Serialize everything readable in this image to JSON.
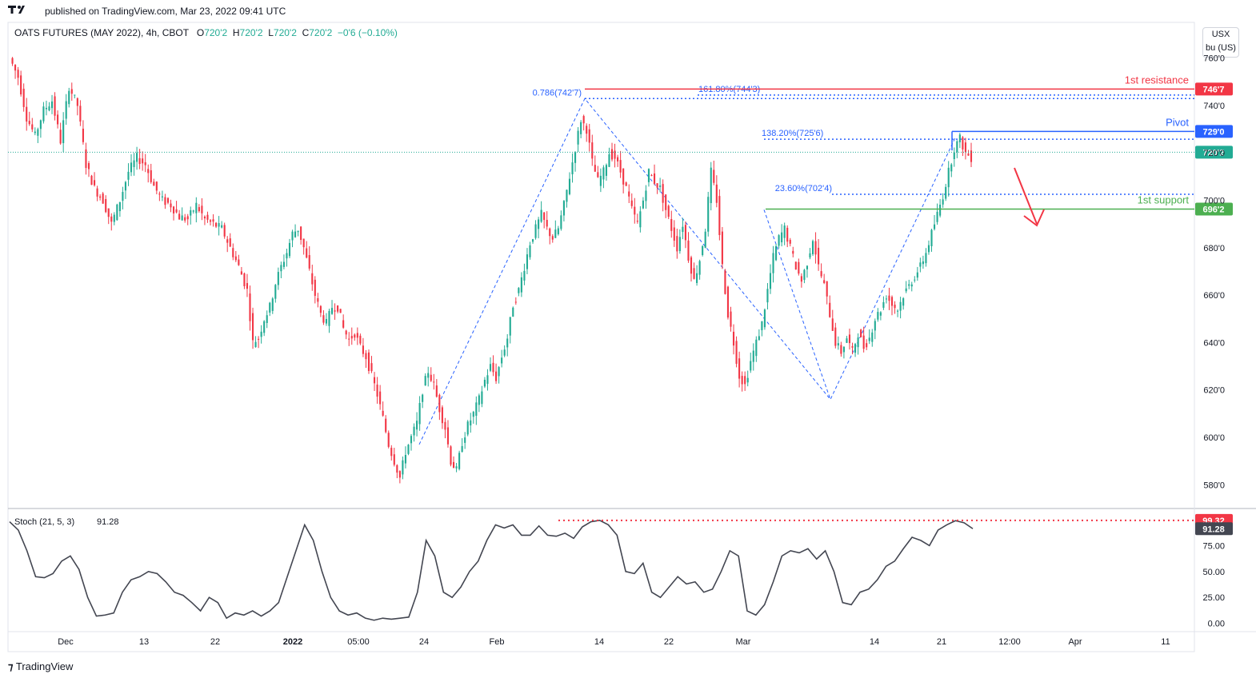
{
  "header": {
    "published_text": "published on TradingView.com, Mar 23, 2022 09:41 UTC",
    "symbol": "OATS FUTURES (MAY 2022), 4h, CBOT",
    "ohlc": {
      "o_label": "O",
      "o": "720'2",
      "h_label": "H",
      "h": "720'2",
      "l_label": "L",
      "l": "720'2",
      "c_label": "C",
      "c": "720'2",
      "change": "−0'6 (−0.10%)"
    }
  },
  "unit_box": {
    "line1": "USX",
    "line2": "bu (US)"
  },
  "footer": {
    "brand": "TradingView"
  },
  "colors": {
    "up": "#22ab94",
    "down": "#f23645",
    "blue": "#2962ff",
    "resist": "#f23645",
    "support": "#4caf50",
    "grid": "#e0e3eb",
    "stoch": "#434651"
  },
  "chart_data": [
    {
      "type": "candlestick",
      "title": "OATS FUTURES (MAY 2022), 4h, CBOT",
      "ylim": [
        570,
        775
      ],
      "y_ticks": [
        {
          "v": 760,
          "label": "760'0"
        },
        {
          "v": 740,
          "label": "740'0"
        },
        {
          "v": 720,
          "label": "720'0"
        },
        {
          "v": 700,
          "label": "700'0"
        },
        {
          "v": 680,
          "label": "680'0"
        },
        {
          "v": 660,
          "label": "660'0"
        },
        {
          "v": 640,
          "label": "640'0"
        },
        {
          "v": 620,
          "label": "620'0"
        },
        {
          "v": 600,
          "label": "600'0"
        },
        {
          "v": 580,
          "label": "580'0"
        }
      ],
      "x_ticks": [
        "Dec",
        "13",
        "22",
        "2022",
        "05:00",
        "24",
        "Feb",
        "14",
        "22",
        "Mar",
        "14",
        "21",
        "12:00",
        "Apr",
        "11"
      ],
      "close_path": [
        [
          0,
          760
        ],
        [
          3,
          752
        ],
        [
          6,
          735
        ],
        [
          9,
          727
        ],
        [
          12,
          738
        ],
        [
          15,
          742
        ],
        [
          18,
          725
        ],
        [
          21,
          748
        ],
        [
          24,
          740
        ],
        [
          27,
          715
        ],
        [
          30,
          705
        ],
        [
          33,
          700
        ],
        [
          36,
          690
        ],
        [
          39,
          700
        ],
        [
          42,
          712
        ],
        [
          45,
          718
        ],
        [
          48,
          715
        ],
        [
          51,
          706
        ],
        [
          54,
          700
        ],
        [
          57,
          698
        ],
        [
          60,
          693
        ],
        [
          63,
          692
        ],
        [
          66,
          698
        ],
        [
          69,
          692
        ],
        [
          72,
          690
        ],
        [
          75,
          688
        ],
        [
          78,
          680
        ],
        [
          81,
          672
        ],
        [
          84,
          662
        ],
        [
          86,
          640
        ],
        [
          88,
          642
        ],
        [
          90,
          650
        ],
        [
          92,
          655
        ],
        [
          94,
          665
        ],
        [
          96,
          672
        ],
        [
          98,
          678
        ],
        [
          100,
          686
        ],
        [
          102,
          688
        ],
        [
          104,
          680
        ],
        [
          106,
          670
        ],
        [
          108,
          660
        ],
        [
          110,
          652
        ],
        [
          112,
          648
        ],
        [
          114,
          655
        ],
        [
          116,
          655
        ],
        [
          118,
          646
        ],
        [
          120,
          641
        ],
        [
          122,
          644
        ],
        [
          124,
          638
        ],
        [
          126,
          634
        ],
        [
          128,
          626
        ],
        [
          130,
          618
        ],
        [
          132,
          608
        ],
        [
          134,
          597
        ],
        [
          136,
          590
        ],
        [
          138,
          583
        ],
        [
          140,
          594
        ],
        [
          142,
          600
        ],
        [
          144,
          606
        ],
        [
          146,
          620
        ],
        [
          148,
          628
        ],
        [
          150,
          622
        ],
        [
          152,
          612
        ],
        [
          154,
          604
        ],
        [
          156,
          590
        ],
        [
          158,
          586
        ],
        [
          160,
          598
        ],
        [
          162,
          605
        ],
        [
          164,
          610
        ],
        [
          166,
          616
        ],
        [
          168,
          624
        ],
        [
          170,
          630
        ],
        [
          172,
          625
        ],
        [
          174,
          634
        ],
        [
          176,
          642
        ],
        [
          178,
          656
        ],
        [
          180,
          662
        ],
        [
          182,
          672
        ],
        [
          184,
          682
        ],
        [
          186,
          688
        ],
        [
          188,
          694
        ],
        [
          190,
          688
        ],
        [
          192,
          684
        ],
        [
          194,
          688
        ],
        [
          196,
          698
        ],
        [
          198,
          710
        ],
        [
          200,
          722
        ],
        [
          202,
          734
        ],
        [
          204,
          730
        ],
        [
          206,
          716
        ],
        [
          208,
          708
        ],
        [
          210,
          712
        ],
        [
          212,
          720
        ],
        [
          214,
          718
        ],
        [
          216,
          712
        ],
        [
          218,
          705
        ],
        [
          220,
          696
        ],
        [
          222,
          690
        ],
        [
          224,
          700
        ],
        [
          226,
          712
        ],
        [
          228,
          708
        ],
        [
          230,
          705
        ],
        [
          232,
          696
        ],
        [
          234,
          688
        ],
        [
          236,
          680
        ],
        [
          238,
          690
        ],
        [
          240,
          676
        ],
        [
          242,
          666
        ],
        [
          244,
          675
        ],
        [
          246,
          688
        ],
        [
          248,
          712
        ],
        [
          250,
          700
        ],
        [
          252,
          672
        ],
        [
          254,
          652
        ],
        [
          256,
          640
        ],
        [
          258,
          626
        ],
        [
          260,
          622
        ],
        [
          262,
          632
        ],
        [
          264,
          640
        ],
        [
          266,
          648
        ],
        [
          268,
          662
        ],
        [
          270,
          676
        ],
        [
          272,
          684
        ],
        [
          274,
          688
        ],
        [
          276,
          680
        ],
        [
          278,
          672
        ],
        [
          280,
          666
        ],
        [
          282,
          674
        ],
        [
          284,
          684
        ],
        [
          286,
          672
        ],
        [
          288,
          664
        ],
        [
          290,
          652
        ],
        [
          292,
          640
        ],
        [
          294,
          636
        ],
        [
          296,
          642
        ],
        [
          298,
          636
        ],
        [
          300,
          644
        ],
        [
          302,
          638
        ],
        [
          304,
          642
        ],
        [
          306,
          650
        ],
        [
          308,
          654
        ],
        [
          310,
          660
        ],
        [
          312,
          656
        ],
        [
          314,
          654
        ],
        [
          316,
          660
        ],
        [
          318,
          664
        ],
        [
          320,
          668
        ],
        [
          322,
          672
        ],
        [
          324,
          678
        ],
        [
          326,
          686
        ],
        [
          328,
          694
        ],
        [
          330,
          702
        ],
        [
          332,
          712
        ],
        [
          334,
          722
        ],
        [
          336,
          726
        ],
        [
          338,
          720
        ],
        [
          340,
          718
        ]
      ],
      "current_price": 720.25,
      "horizontal_levels": [
        {
          "label": "1st resistance",
          "tag": "746'7",
          "value": 746.875,
          "color": "#f23645"
        },
        {
          "label": "Pivot",
          "tag": "729'0",
          "value": 729,
          "color": "#2962ff"
        },
        {
          "label": "1st support",
          "tag": "696'2",
          "value": 696.25,
          "color": "#4caf50"
        },
        {
          "label": "",
          "tag": "720'2",
          "value": 720.25,
          "color": "#22ab94"
        }
      ],
      "fib_levels": [
        {
          "label": "0.786(742'7)",
          "value": 742.875
        },
        {
          "label": "161.80%(744'3)",
          "value": 744.375
        },
        {
          "label": "138.20%(725'6)",
          "value": 725.75
        },
        {
          "label": "23.60%(702'4)",
          "value": 702.5
        }
      ],
      "annotations": [
        "1st resistance",
        "Pivot",
        "1st support"
      ]
    },
    {
      "type": "line",
      "title": "Stoch (21, 5, 3)",
      "last_value": "91.28",
      "ylim": [
        -8,
        110
      ],
      "y_ticks": [
        {
          "v": 75,
          "label": "75.00"
        },
        {
          "v": 50,
          "label": "50.00"
        },
        {
          "v": 25,
          "label": "25.00"
        },
        {
          "v": 0,
          "label": "0.00"
        }
      ],
      "level_tag": "99.32",
      "level_value": 99.32,
      "value_tag": "91.28",
      "values": [
        98,
        90,
        70,
        45,
        44,
        48,
        60,
        65,
        52,
        25,
        7,
        8,
        10,
        30,
        42,
        45,
        50,
        48,
        40,
        30,
        27,
        20,
        12,
        25,
        20,
        5,
        10,
        8,
        12,
        7,
        12,
        20,
        45,
        70,
        95,
        80,
        50,
        25,
        12,
        8,
        10,
        5,
        3,
        5,
        4,
        5,
        6,
        30,
        80,
        65,
        30,
        25,
        35,
        50,
        60,
        80,
        95,
        92,
        95,
        85,
        85,
        94,
        85,
        84,
        87,
        82,
        93,
        98,
        99.32,
        95,
        85,
        50,
        48,
        58,
        30,
        25,
        35,
        45,
        38,
        40,
        30,
        33,
        50,
        70,
        65,
        12,
        8,
        18,
        40,
        65,
        70,
        68,
        72,
        62,
        70,
        50,
        20,
        18,
        30,
        33,
        42,
        55,
        60,
        72,
        83,
        80,
        75,
        90,
        95,
        99,
        97,
        91.28
      ]
    }
  ]
}
